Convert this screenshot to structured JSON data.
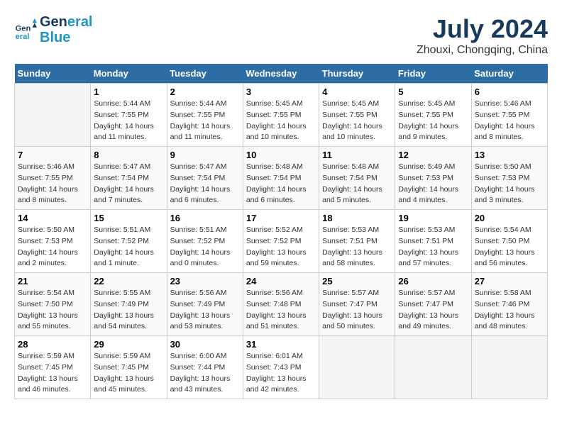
{
  "logo": {
    "line1": "General",
    "line2": "Blue"
  },
  "title": "July 2024",
  "subtitle": "Zhouxi, Chongqing, China",
  "days_of_week": [
    "Sunday",
    "Monday",
    "Tuesday",
    "Wednesday",
    "Thursday",
    "Friday",
    "Saturday"
  ],
  "weeks": [
    [
      {
        "day": "",
        "info": ""
      },
      {
        "day": "1",
        "info": "Sunrise: 5:44 AM\nSunset: 7:55 PM\nDaylight: 14 hours\nand 11 minutes."
      },
      {
        "day": "2",
        "info": "Sunrise: 5:44 AM\nSunset: 7:55 PM\nDaylight: 14 hours\nand 11 minutes."
      },
      {
        "day": "3",
        "info": "Sunrise: 5:45 AM\nSunset: 7:55 PM\nDaylight: 14 hours\nand 10 minutes."
      },
      {
        "day": "4",
        "info": "Sunrise: 5:45 AM\nSunset: 7:55 PM\nDaylight: 14 hours\nand 10 minutes."
      },
      {
        "day": "5",
        "info": "Sunrise: 5:45 AM\nSunset: 7:55 PM\nDaylight: 14 hours\nand 9 minutes."
      },
      {
        "day": "6",
        "info": "Sunrise: 5:46 AM\nSunset: 7:55 PM\nDaylight: 14 hours\nand 8 minutes."
      }
    ],
    [
      {
        "day": "7",
        "info": "Sunrise: 5:46 AM\nSunset: 7:55 PM\nDaylight: 14 hours\nand 8 minutes."
      },
      {
        "day": "8",
        "info": "Sunrise: 5:47 AM\nSunset: 7:54 PM\nDaylight: 14 hours\nand 7 minutes."
      },
      {
        "day": "9",
        "info": "Sunrise: 5:47 AM\nSunset: 7:54 PM\nDaylight: 14 hours\nand 6 minutes."
      },
      {
        "day": "10",
        "info": "Sunrise: 5:48 AM\nSunset: 7:54 PM\nDaylight: 14 hours\nand 6 minutes."
      },
      {
        "day": "11",
        "info": "Sunrise: 5:48 AM\nSunset: 7:54 PM\nDaylight: 14 hours\nand 5 minutes."
      },
      {
        "day": "12",
        "info": "Sunrise: 5:49 AM\nSunset: 7:53 PM\nDaylight: 14 hours\nand 4 minutes."
      },
      {
        "day": "13",
        "info": "Sunrise: 5:50 AM\nSunset: 7:53 PM\nDaylight: 14 hours\nand 3 minutes."
      }
    ],
    [
      {
        "day": "14",
        "info": "Sunrise: 5:50 AM\nSunset: 7:53 PM\nDaylight: 14 hours\nand 2 minutes."
      },
      {
        "day": "15",
        "info": "Sunrise: 5:51 AM\nSunset: 7:52 PM\nDaylight: 14 hours\nand 1 minute."
      },
      {
        "day": "16",
        "info": "Sunrise: 5:51 AM\nSunset: 7:52 PM\nDaylight: 14 hours\nand 0 minutes."
      },
      {
        "day": "17",
        "info": "Sunrise: 5:52 AM\nSunset: 7:52 PM\nDaylight: 13 hours\nand 59 minutes."
      },
      {
        "day": "18",
        "info": "Sunrise: 5:53 AM\nSunset: 7:51 PM\nDaylight: 13 hours\nand 58 minutes."
      },
      {
        "day": "19",
        "info": "Sunrise: 5:53 AM\nSunset: 7:51 PM\nDaylight: 13 hours\nand 57 minutes."
      },
      {
        "day": "20",
        "info": "Sunrise: 5:54 AM\nSunset: 7:50 PM\nDaylight: 13 hours\nand 56 minutes."
      }
    ],
    [
      {
        "day": "21",
        "info": "Sunrise: 5:54 AM\nSunset: 7:50 PM\nDaylight: 13 hours\nand 55 minutes."
      },
      {
        "day": "22",
        "info": "Sunrise: 5:55 AM\nSunset: 7:49 PM\nDaylight: 13 hours\nand 54 minutes."
      },
      {
        "day": "23",
        "info": "Sunrise: 5:56 AM\nSunset: 7:49 PM\nDaylight: 13 hours\nand 53 minutes."
      },
      {
        "day": "24",
        "info": "Sunrise: 5:56 AM\nSunset: 7:48 PM\nDaylight: 13 hours\nand 51 minutes."
      },
      {
        "day": "25",
        "info": "Sunrise: 5:57 AM\nSunset: 7:47 PM\nDaylight: 13 hours\nand 50 minutes."
      },
      {
        "day": "26",
        "info": "Sunrise: 5:57 AM\nSunset: 7:47 PM\nDaylight: 13 hours\nand 49 minutes."
      },
      {
        "day": "27",
        "info": "Sunrise: 5:58 AM\nSunset: 7:46 PM\nDaylight: 13 hours\nand 48 minutes."
      }
    ],
    [
      {
        "day": "28",
        "info": "Sunrise: 5:59 AM\nSunset: 7:45 PM\nDaylight: 13 hours\nand 46 minutes."
      },
      {
        "day": "29",
        "info": "Sunrise: 5:59 AM\nSunset: 7:45 PM\nDaylight: 13 hours\nand 45 minutes."
      },
      {
        "day": "30",
        "info": "Sunrise: 6:00 AM\nSunset: 7:44 PM\nDaylight: 13 hours\nand 43 minutes."
      },
      {
        "day": "31",
        "info": "Sunrise: 6:01 AM\nSunset: 7:43 PM\nDaylight: 13 hours\nand 42 minutes."
      },
      {
        "day": "",
        "info": ""
      },
      {
        "day": "",
        "info": ""
      },
      {
        "day": "",
        "info": ""
      }
    ]
  ]
}
